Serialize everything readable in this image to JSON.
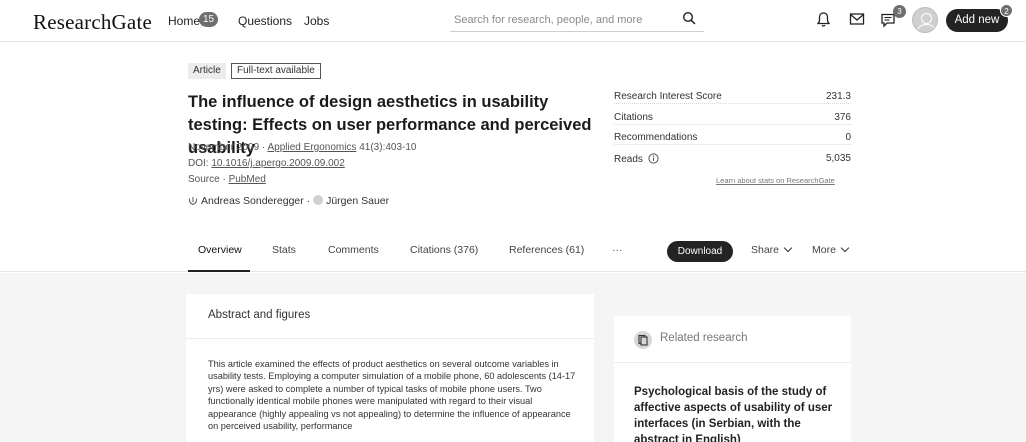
{
  "nav": {
    "logo": "ResearchGate",
    "home_label": "Home",
    "home_badge": "15",
    "questions_label": "Questions",
    "jobs_label": "Jobs",
    "search_placeholder": "Search for research, people, and more",
    "chat_badge": "3",
    "add_new_label": "Add new",
    "add_new_badge": "2",
    "icons": [
      "search-icon",
      "bell-icon",
      "mail-icon",
      "chat-icon",
      "avatar"
    ]
  },
  "article": {
    "type_tag": "Article",
    "fulltext_tag": "Full-text available",
    "title": "The influence of design aesthetics in usability testing: Effects on user performance and perceived usability",
    "date": "November 2009",
    "journal": "Applied Ergonomics",
    "journal_ref": "41(3):403-10",
    "doi_label": "DOI:",
    "doi": "10.1016/j.apergo.2009.09.002",
    "source_label": "Source ·",
    "source": "PubMed",
    "authors": [
      "Andreas Sonderegger",
      "Jürgen Sauer"
    ]
  },
  "stats": {
    "rows": [
      {
        "label": "Research Interest Score",
        "value": "231.3"
      },
      {
        "label": "Citations",
        "value": "376"
      },
      {
        "label": "Recommendations",
        "value": "0"
      },
      {
        "label": "Reads",
        "value": "5,035"
      }
    ],
    "learn_more": "Learn about stats on ResearchGate"
  },
  "tabs": {
    "items": [
      "Overview",
      "Stats",
      "Comments",
      "Citations (376)",
      "References (61)",
      "···"
    ],
    "active": "Overview",
    "download_label": "Download",
    "share_label": "Share",
    "more_label": "More"
  },
  "abstract": {
    "heading": "Abstract and figures",
    "text": "This article examined the effects of product aesthetics on several outcome variables in usability tests. Employing a computer simulation of a mobile phone, 60 adolescents (14-17 yrs) were asked to complete a number of typical tasks of mobile phone users. Two functionally identical mobile phones were manipulated with regard to their visual appearance (highly appealing vs not appealing) to determine the influence of appearance on perceived usability, performance"
  },
  "related": {
    "heading": "Related research",
    "first_title": "Psychological basis of the study of affective aspects of usability of user interfaces (in Serbian, with the abstract in English)"
  },
  "colors": {
    "dark_button": "#232323",
    "badge": "#6e6e6e",
    "page_bg": "#f5f5f5"
  }
}
